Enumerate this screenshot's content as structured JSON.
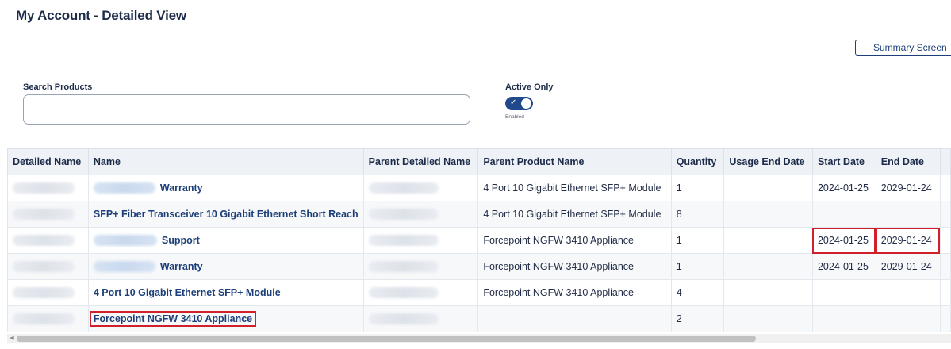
{
  "page": {
    "title": "My Account - Detailed View",
    "summary_button": "Summary Screen"
  },
  "search": {
    "label": "Search Products",
    "value": "",
    "placeholder": ""
  },
  "filter": {
    "label": "Active Only",
    "toggle_on": true,
    "toggle_check": "✓",
    "state_label": "Enabled"
  },
  "table": {
    "columns": [
      "Detailed Name",
      "Name",
      "Parent Detailed Name",
      "Parent Product Name",
      "Quantity",
      "Usage End Date",
      "Start Date",
      "End Date"
    ],
    "rows": [
      {
        "name": "Warranty",
        "parent_product_name": "4 Port 10 Gigabit Ethernet SFP+ Module",
        "quantity": "1",
        "usage_end_date": "",
        "start_date": "2024-01-25",
        "end_date": "2029-01-24"
      },
      {
        "name": "SFP+ Fiber Transceiver 10 Gigabit Ethernet Short Reach",
        "parent_product_name": "4 Port 10 Gigabit Ethernet SFP+ Module",
        "quantity": "8",
        "usage_end_date": "",
        "start_date": "",
        "end_date": ""
      },
      {
        "name": "Support",
        "parent_product_name": "Forcepoint NGFW 3410 Appliance",
        "quantity": "1",
        "usage_end_date": "",
        "start_date": "2024-01-25",
        "end_date": "2029-01-24"
      },
      {
        "name": "Warranty",
        "parent_product_name": "Forcepoint NGFW 3410 Appliance",
        "quantity": "1",
        "usage_end_date": "",
        "start_date": "2024-01-25",
        "end_date": "2029-01-24"
      },
      {
        "name": "4 Port 10 Gigabit Ethernet SFP+ Module",
        "parent_product_name": "Forcepoint NGFW 3410 Appliance",
        "quantity": "4",
        "usage_end_date": "",
        "start_date": "",
        "end_date": ""
      },
      {
        "name": "Forcepoint NGFW 3410 Appliance",
        "parent_product_name": "",
        "quantity": "2",
        "usage_end_date": "",
        "start_date": "",
        "end_date": ""
      }
    ]
  },
  "scrollbar": {
    "left_arrow": "◀"
  },
  "colors": {
    "accent": "#1e4a8c",
    "link": "#1c3f7a",
    "highlight": "#d0202a",
    "header_bg": "#eef1f5"
  }
}
